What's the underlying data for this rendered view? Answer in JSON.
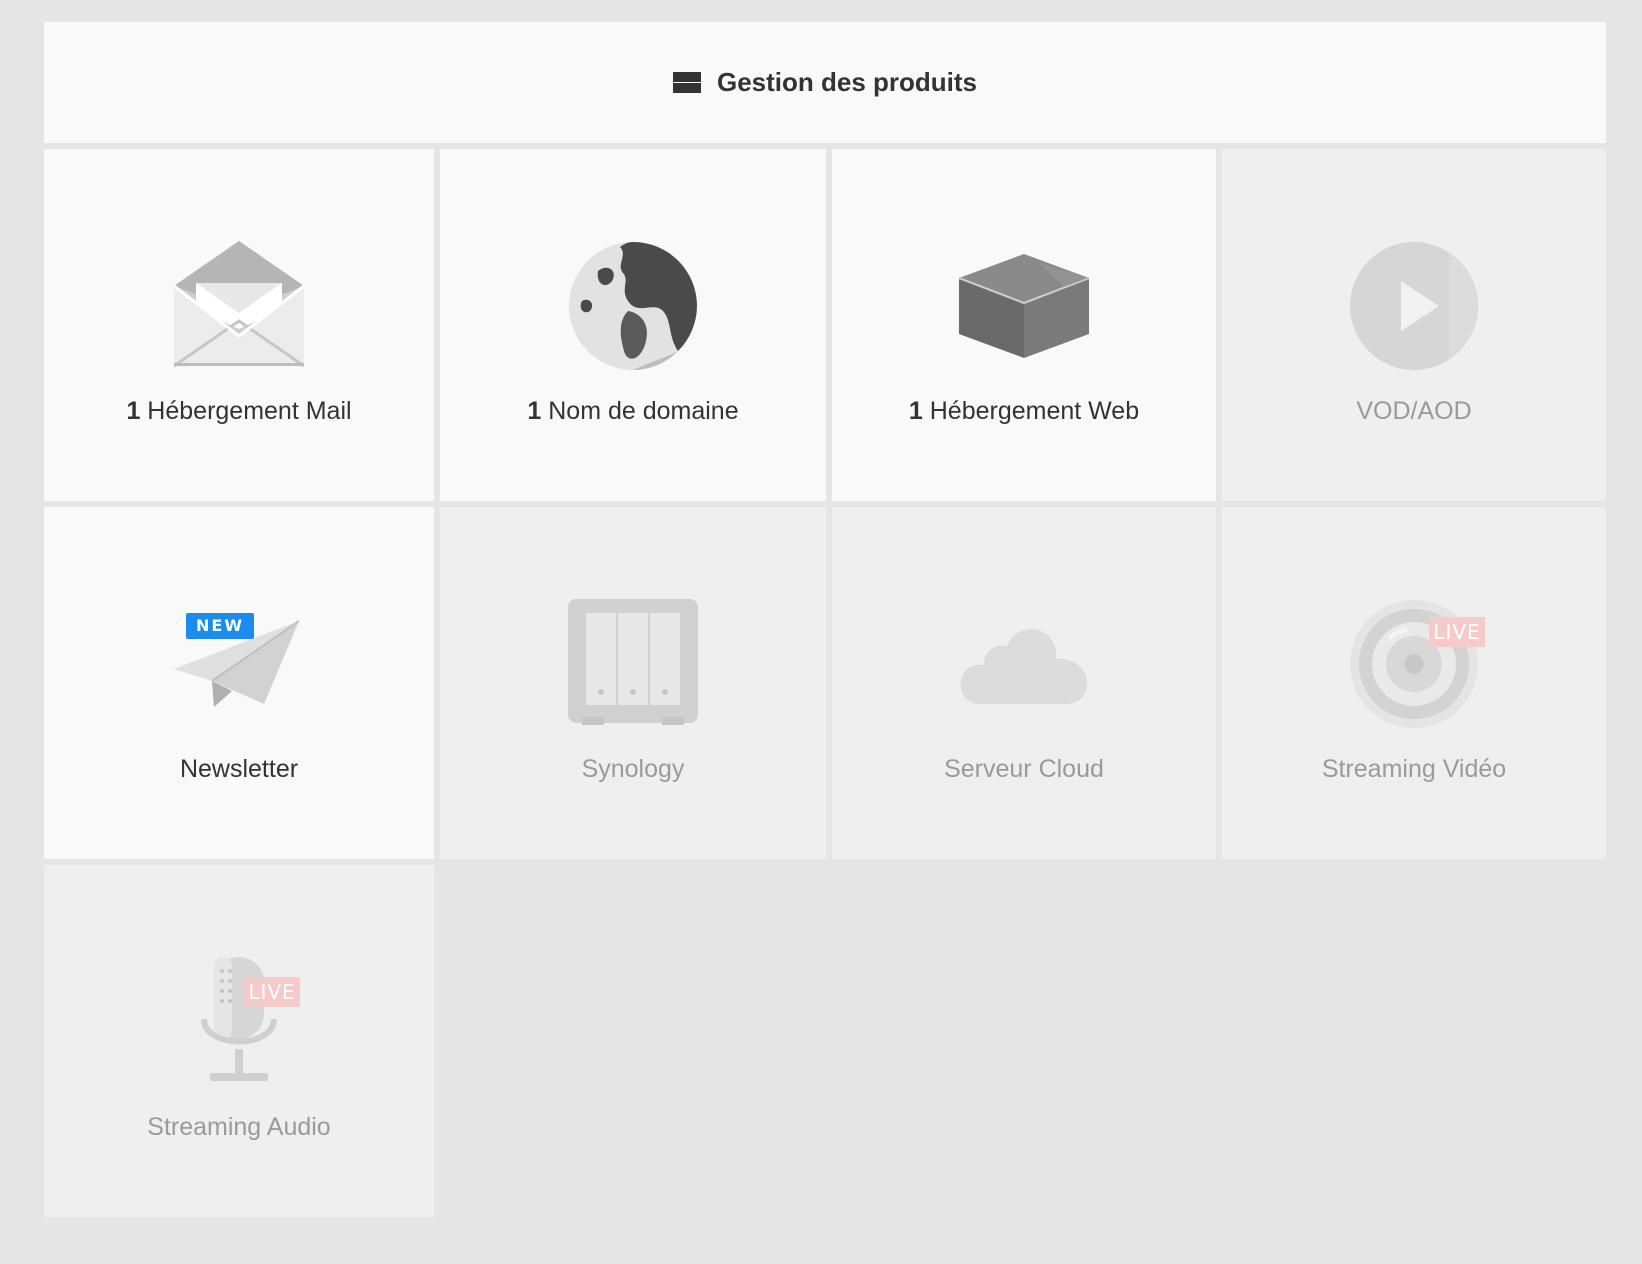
{
  "header": {
    "title": "Gestion des produits",
    "icon": "menu-icon"
  },
  "products": [
    {
      "count": "1",
      "label": "Hébergement Mail",
      "icon": "envelope-icon",
      "active": true
    },
    {
      "count": "1",
      "label": "Nom de domaine",
      "icon": "globe-icon",
      "active": true
    },
    {
      "count": "1",
      "label": "Hébergement Web",
      "icon": "box-icon",
      "active": true
    },
    {
      "count": "",
      "label": "VOD/AOD",
      "icon": "play-icon",
      "active": false
    },
    {
      "count": "",
      "label": "Newsletter",
      "icon": "paper-plane-icon",
      "badge": "NEW",
      "active": true
    },
    {
      "count": "",
      "label": "Synology",
      "icon": "nas-icon",
      "active": false
    },
    {
      "count": "",
      "label": "Serveur Cloud",
      "icon": "cloud-icon",
      "active": false
    },
    {
      "count": "",
      "label": "Streaming Vidéo",
      "icon": "camera-lens-icon",
      "badge": "LIVE",
      "active": false
    },
    {
      "count": "",
      "label": "Streaming Audio",
      "icon": "microphone-icon",
      "badge": "LIVE",
      "active": false
    }
  ],
  "colors": {
    "background": "#e5e5e5",
    "tile_active": "#f9f9f9",
    "tile_disabled": "#efefef",
    "badge_new": "#1a8cf0",
    "badge_live": "#f7caca"
  }
}
